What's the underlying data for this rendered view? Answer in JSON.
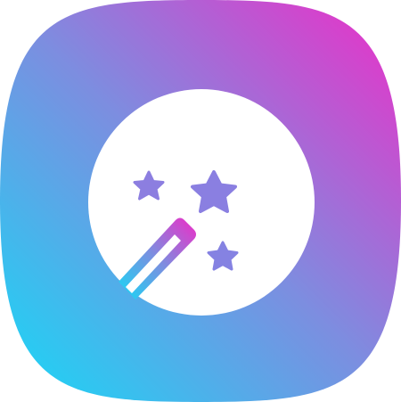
{
  "icon": {
    "semantic": "magic-wand-icon",
    "elements": [
      "circle-badge",
      "wand-handle",
      "stars"
    ],
    "colors": {
      "gradient_start": "#16D9F6",
      "gradient_mid": "#7C8EE0",
      "gradient_end": "#EE2DC7",
      "badge_fill": "#FFFFFF",
      "glyph_fill": "#8C7EE2"
    }
  }
}
